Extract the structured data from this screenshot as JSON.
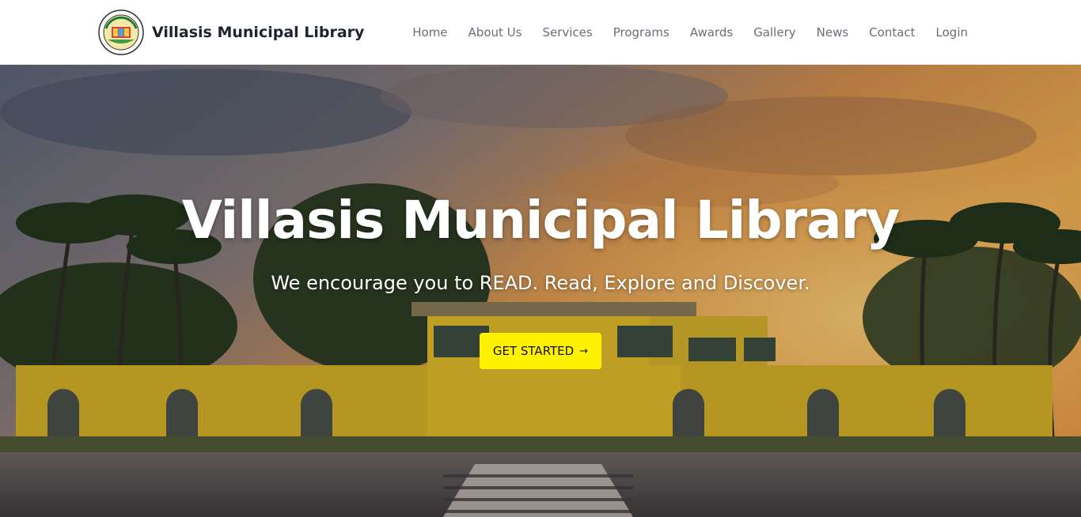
{
  "header": {
    "brand_name": "Villasis Municipal Library",
    "logo_icon": "municipal-library-seal-icon",
    "nav": [
      {
        "label": "Home"
      },
      {
        "label": "About Us"
      },
      {
        "label": "Services"
      },
      {
        "label": "Programs"
      },
      {
        "label": "Awards"
      },
      {
        "label": "Gallery"
      },
      {
        "label": "News"
      },
      {
        "label": "Contact"
      },
      {
        "label": "Login"
      }
    ]
  },
  "hero": {
    "title": "Villasis Municipal Library",
    "subtitle": "We encourage you to READ. Read, Explore and Discover.",
    "cta_label": "GET STARTED",
    "cta_icon": "arrow-right-icon",
    "background_image": "villasis-town-hall-sunset-photo"
  },
  "colors": {
    "cta_background": "#fff200",
    "nav_text": "#6b6f76",
    "brand_text": "#1f2430",
    "hero_text": "#ffffff"
  }
}
